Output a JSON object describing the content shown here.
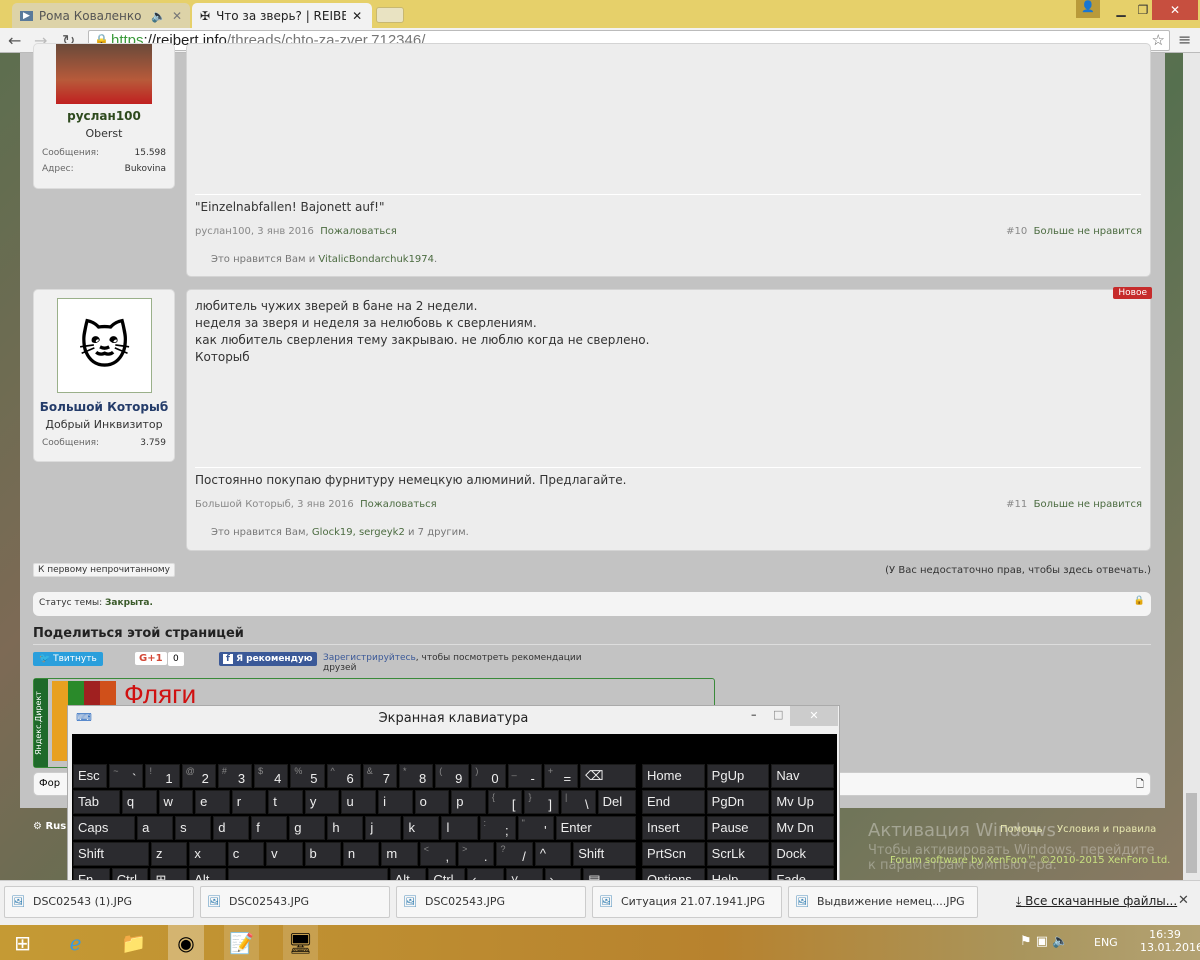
{
  "browser": {
    "tabs": [
      {
        "title": "Рома Коваленко"
      },
      {
        "title": "Что за зверь? | REIBERT.info"
      }
    ],
    "url_scheme": "https",
    "url_host": "://reibert.info",
    "url_path": "/threads/chto-za-zver.712346/"
  },
  "posts": [
    {
      "user": "руслан100",
      "title": "Oberst",
      "stats": [
        {
          "label": "Сообщения:",
          "value": "15.598"
        },
        {
          "label": "Адрес:",
          "value": "Bukovina"
        }
      ],
      "body": [],
      "signature": "\"Einzelnabfallen! Bajonett auf!\"",
      "author_date": "руслан100, 3 янв 2016",
      "report": "Пожаловаться",
      "number": "#10",
      "unlike": "Больше не нравится",
      "likes_prefix": "Это нравится Вам и ",
      "likes_users": "VitalicBondarchuk1974",
      "likes_suffix": "."
    },
    {
      "user": "Большой Которыб",
      "title": "Добрый Инквизитор",
      "badge": "Новое",
      "stats": [
        {
          "label": "Сообщения:",
          "value": "3.759"
        }
      ],
      "body": [
        "любитель чужих зверей в бане на 2 недели.",
        "неделя за зверя и неделя за нелюбовь к сверлениям.",
        "как любитель сверления тему закрываю. не люблю когда не сверлено.",
        "Которыб"
      ],
      "signature": "Постоянно покупаю фурнитуру немецкую алюминий. Предлагайте.",
      "author_date": "Большой Которыб, 3 янв 2016",
      "report": "Пожаловаться",
      "number": "#11",
      "unlike": "Больше не нравится",
      "likes_prefix": "Это нравится Вам, ",
      "likes_users": "Glock19, sergeyk2",
      "likes_suffix": " и 7 другим."
    }
  ],
  "thread": {
    "first_unread": "К первому непрочитанному",
    "no_rights": "(У Вас недостаточно прав, чтобы здесь отвечать.)",
    "status_label": "Статус темы:",
    "status_value": "Закрыта.",
    "share_title": "Поделиться этой страницей",
    "tweet": "Твитнуть",
    "gplus": "G+1",
    "gplus_count": "0",
    "fb": "Я рекомендую",
    "fb_register": "Зарегистрируйтесь",
    "fb_text": ", чтобы посмотреть рекомендации друзей",
    "ad_label": "Яндекс.Директ",
    "ad_title": "Фляги",
    "forum_input": "Фор",
    "footer_lang": "Rus",
    "footer_help": "Помощь",
    "footer_terms": "Условия и правила",
    "footer_copy": "Forum software by XenForo™ ©2010-2015 XenForo Ltd.",
    "watermark_title": "Активация Windows",
    "watermark_text": "Чтобы активировать Windows, перейдите к параметрам компьютера."
  },
  "osk": {
    "title": "Экранная клавиатура",
    "rows": [
      [
        [
          "Esc"
        ],
        [
          "~",
          "`"
        ],
        [
          "!",
          "1"
        ],
        [
          "@",
          "2"
        ],
        [
          "#",
          "3"
        ],
        [
          "$",
          "4"
        ],
        [
          "%",
          "5"
        ],
        [
          "^",
          "6"
        ],
        [
          "&",
          "7"
        ],
        [
          "*",
          "8"
        ],
        [
          "(",
          "9"
        ],
        [
          ")",
          "0"
        ],
        [
          "_",
          "-"
        ],
        [
          "+",
          "="
        ],
        [
          "⌫"
        ]
      ],
      [
        [
          "Tab"
        ],
        [
          "q"
        ],
        [
          "w"
        ],
        [
          "e"
        ],
        [
          "r"
        ],
        [
          "t"
        ],
        [
          "y"
        ],
        [
          "u"
        ],
        [
          "i"
        ],
        [
          "o"
        ],
        [
          "p"
        ],
        [
          "{",
          "["
        ],
        [
          "}",
          "]"
        ],
        [
          "|",
          "\\"
        ],
        [
          "Del"
        ]
      ],
      [
        [
          "Caps"
        ],
        [
          "a"
        ],
        [
          "s"
        ],
        [
          "d"
        ],
        [
          "f"
        ],
        [
          "g"
        ],
        [
          "h"
        ],
        [
          "j"
        ],
        [
          "k"
        ],
        [
          "l"
        ],
        [
          ":",
          ";"
        ],
        [
          "\"",
          "'"
        ],
        [
          "Enter"
        ]
      ],
      [
        [
          "Shift"
        ],
        [
          "z"
        ],
        [
          "x"
        ],
        [
          "c"
        ],
        [
          "v"
        ],
        [
          "b"
        ],
        [
          "n"
        ],
        [
          "m"
        ],
        [
          "<",
          ","
        ],
        [
          ">",
          "."
        ],
        [
          "?",
          "/"
        ],
        [
          "^"
        ],
        [
          "Shift"
        ]
      ],
      [
        [
          "Fn"
        ],
        [
          "Ctrl"
        ],
        [
          "⊞"
        ],
        [
          "Alt"
        ],
        [
          ""
        ],
        [
          "Alt"
        ],
        [
          "Ctrl"
        ],
        [
          "‹"
        ],
        [
          "˅"
        ],
        [
          "›"
        ],
        [
          "▤"
        ]
      ]
    ],
    "nav": [
      [
        "Home",
        "PgUp",
        "Nav"
      ],
      [
        "End",
        "PgDn",
        "Mv Up"
      ],
      [
        "Insert",
        "Pause",
        "Mv Dn"
      ],
      [
        "PrtScn",
        "ScrLk",
        "Dock"
      ],
      [
        "Options",
        "Help",
        "Fade"
      ]
    ]
  },
  "downloads": {
    "items": [
      "DSC02543 (1).JPG",
      "DSC02543.JPG",
      "DSC02543.JPG",
      "Ситуация 21.07.1941.JPG",
      "Выдвижение немец....JPG"
    ],
    "all": "Все скачанные файлы..."
  },
  "tray": {
    "lang": "ENG",
    "time": "16:39",
    "date": "13.01.2016"
  }
}
